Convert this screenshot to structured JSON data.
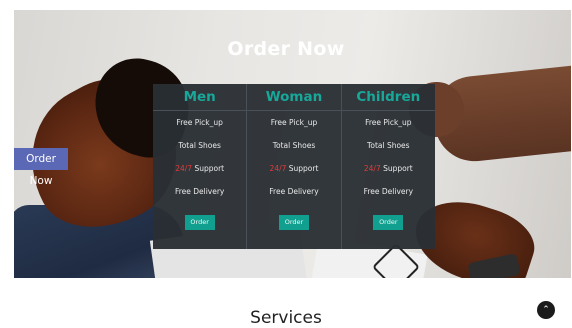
{
  "hero": {
    "title": "Order Now"
  },
  "side_tab": {
    "label": "Order Now"
  },
  "plans": [
    {
      "name": "Men",
      "features": [
        "Free Pick_up",
        "Total Shoes",
        "24/7 Support",
        "Free Delivery"
      ],
      "highlight": "24/7",
      "support_rest": " Support",
      "button": "Order"
    },
    {
      "name": "Woman",
      "features": [
        "Free Pick_up",
        "Total Shoes",
        "24/7 Support",
        "Free Delivery"
      ],
      "highlight": "24/7",
      "support_rest": " Support",
      "button": "Order"
    },
    {
      "name": "Children",
      "features": [
        "Free Pick_up",
        "Total Shoes",
        "24/7 Support",
        "Free Delivery"
      ],
      "highlight": "24/7",
      "support_rest": " Support",
      "button": "Order"
    }
  ],
  "services": {
    "heading": "Services"
  },
  "scroll_top": {
    "icon": "chevron-up-icon",
    "glyph": "⌃"
  },
  "colors": {
    "accent": "#17a89a",
    "button": "#11a08f",
    "highlight": "#e23b3b",
    "side_tab": "#5b68b5"
  }
}
